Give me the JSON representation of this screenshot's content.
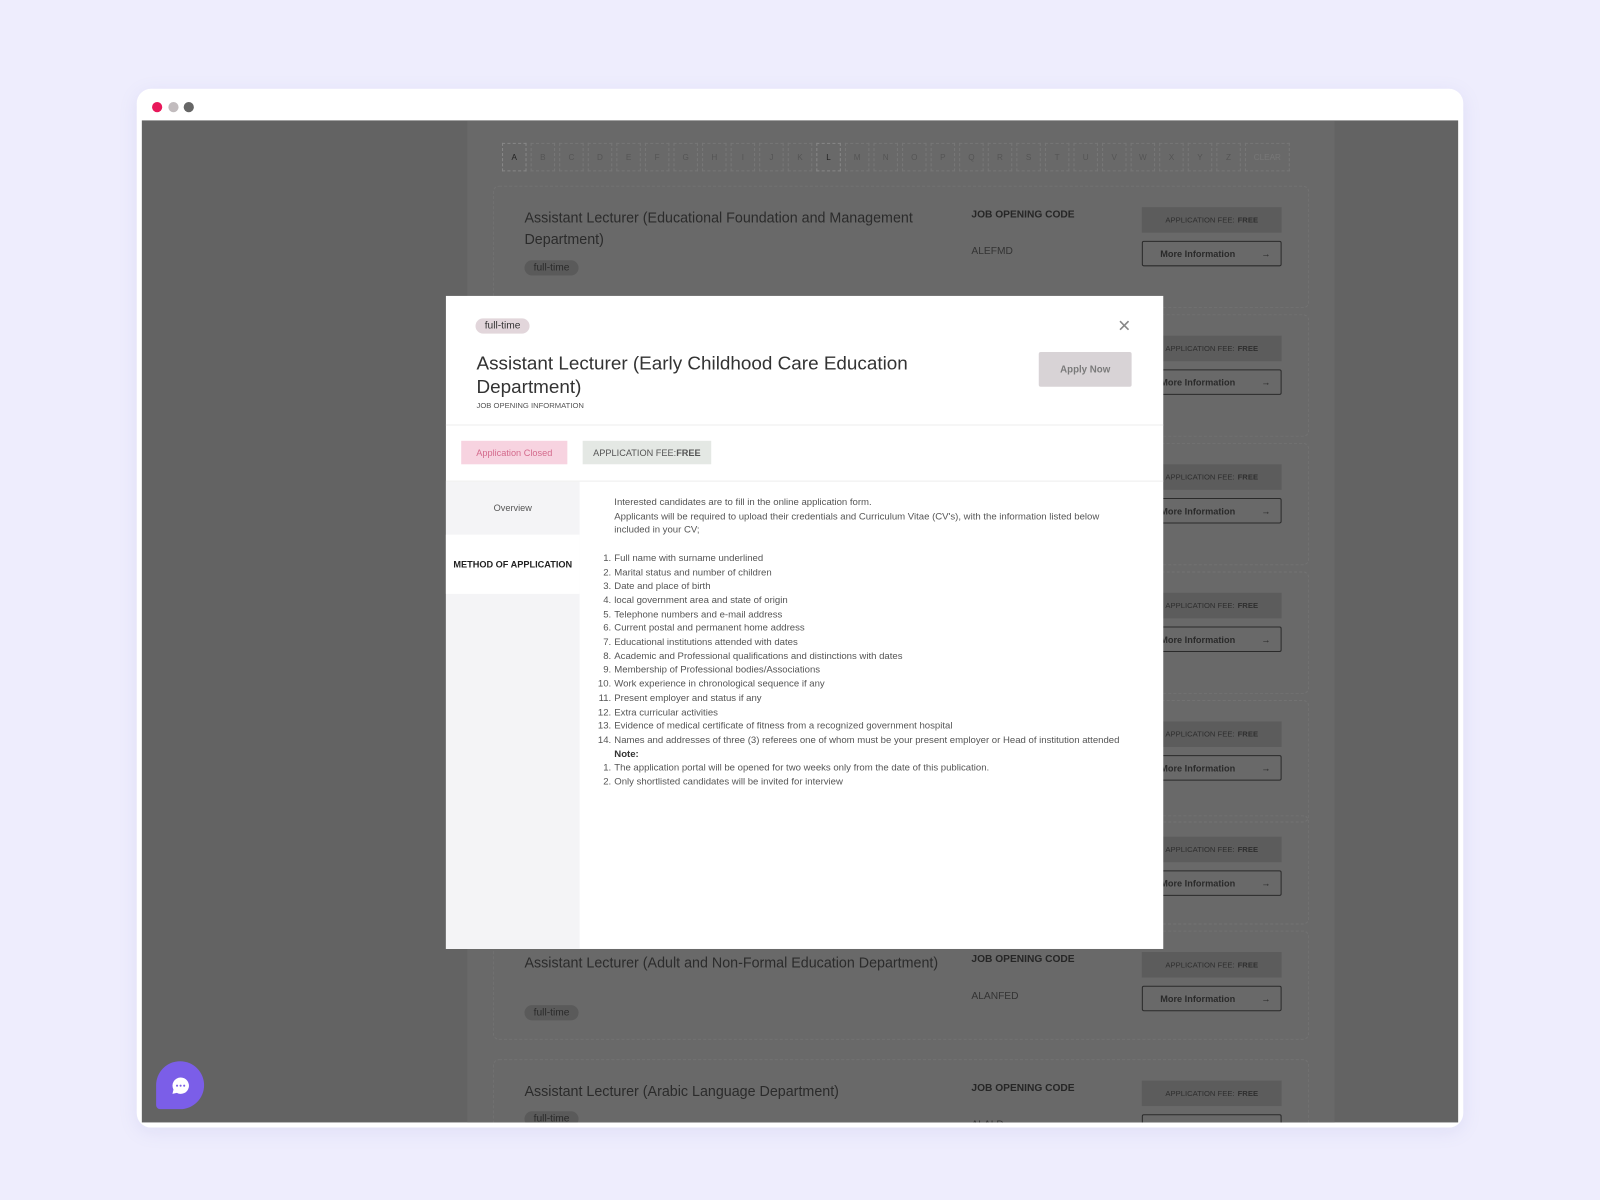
{
  "window": {
    "dots": [
      "#e8185a",
      "#c2bcbe",
      "#666666"
    ]
  },
  "alphabet": [
    "A",
    "B",
    "C",
    "D",
    "E",
    "F",
    "G",
    "H",
    "I",
    "J",
    "K",
    "L",
    "M",
    "N",
    "O",
    "P",
    "Q",
    "R",
    "S",
    "T",
    "U",
    "V",
    "W",
    "X",
    "Y",
    "Z"
  ],
  "alphabet_active": [
    "A",
    "L"
  ],
  "alphabet_clear": "CLEAR",
  "code_label": "JOB OPENING CODE",
  "fee_label": "APPLICATION FEE:",
  "fee_value": "FREE",
  "more_label": "More Information",
  "arrow": "→",
  "cards": [
    {
      "title": "Assistant Lecturer (Educational Foundation and Management Department)",
      "tag": "full-time",
      "code": "ALEFMD"
    },
    {
      "title": "",
      "tag": "",
      "code": ""
    },
    {
      "title": "",
      "tag": "",
      "code": ""
    },
    {
      "title": "",
      "tag": "",
      "code": ""
    },
    {
      "title": "",
      "tag": "",
      "code": ""
    },
    {
      "title": "",
      "tag": "",
      "code": ""
    },
    {
      "title": "Assistant Lecturer (Adult and Non-Formal Education Department)",
      "tag": "full-time",
      "code": "ALANFED"
    },
    {
      "title": "Assistant Lecturer (Arabic Language Department)",
      "tag": "full-time",
      "code": "ALALD"
    }
  ],
  "modal": {
    "tag": "full-time",
    "title": "Assistant Lecturer (Early Childhood Care Education Department)",
    "subtitle": "JOB OPENING INFORMATION",
    "apply": "Apply Now",
    "close_icon": "close-icon",
    "status": "Application Closed",
    "fee_label": "APPLICATION FEE:",
    "fee_value": "FREE",
    "tabs": [
      {
        "label": "Overview",
        "active": false
      },
      {
        "label": "METHOD OF APPLICATION",
        "active": true
      }
    ],
    "intro": [
      "Interested candidates are to fill in the online application form.",
      "Applicants will be required to upload their credentials and Curriculum Vitae (CV's),  with the information listed below included in your CV;"
    ],
    "requirements": [
      "Full name with surname underlined",
      " Marital status and number of children",
      "Date and place of birth",
      "local government area and state of origin",
      "Telephone numbers and e-mail address",
      "Current postal and permanent home address",
      "Educational institutions attended with dates",
      "Academic and Professional qualifications and distinctions with dates",
      "Membership of Professional bodies/Associations",
      "Work experience in chronological sequence if any",
      "Present employer and status if any",
      "Extra curricular activities",
      "Evidence of medical certificate of fitness from a recognized government hospital",
      "Names and addresses of three (3) referees one of whom must be your present employer or Head of institution attended"
    ],
    "note_label": "Note:",
    "notes": [
      "The application portal will be opened for two weeks only from the date of this publication.",
      "Only shortlisted candidates will be invited for interview"
    ]
  },
  "chat_icon": "chat-bubble-icon"
}
